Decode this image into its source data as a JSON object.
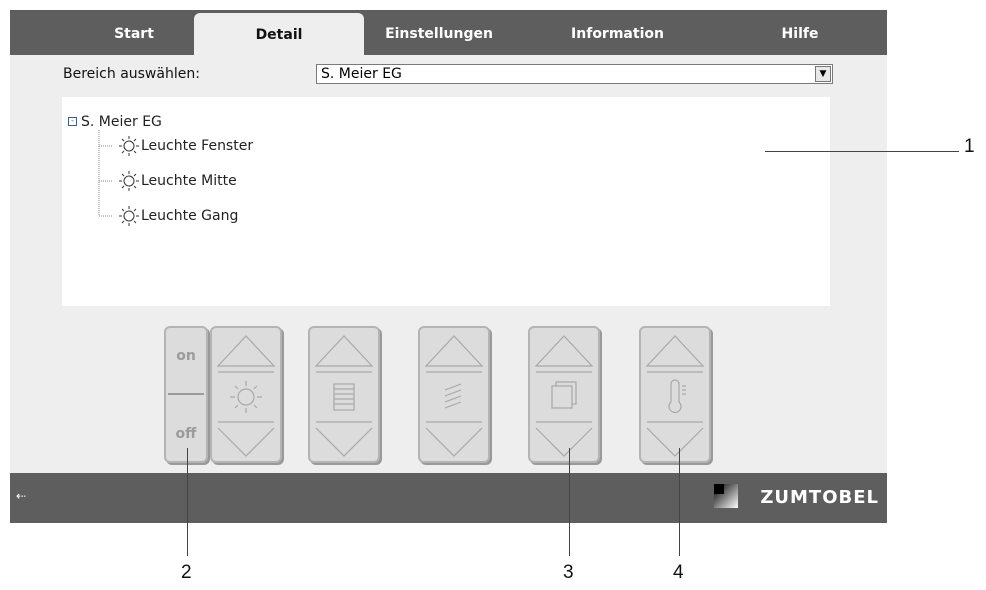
{
  "tabs": [
    {
      "label": "Start",
      "active": false
    },
    {
      "label": "Detail",
      "active": true
    },
    {
      "label": "Einstellungen",
      "active": false
    },
    {
      "label": "Information",
      "active": false
    },
    {
      "label": "Hilfe",
      "active": false
    }
  ],
  "area": {
    "label": "Bereich auswählen:",
    "selected": "S. Meier EG"
  },
  "tree": {
    "root": "S. Meier EG",
    "items": [
      "Leuchte Fenster",
      "Leuchte Mitte",
      "Leuchte Gang"
    ]
  },
  "controls": {
    "on_label": "on",
    "off_label": "off",
    "buttons": [
      {
        "icon": "brightness-icon"
      },
      {
        "icon": "blinds-icon"
      },
      {
        "icon": "slats-icon"
      },
      {
        "icon": "window-icon"
      },
      {
        "icon": "thermometer-icon"
      }
    ]
  },
  "footer": {
    "brand": "ZUMTOBEL",
    "exit_icon": "⇠"
  },
  "callouts": [
    "1",
    "2",
    "3",
    "4"
  ],
  "colors": {
    "bar": "#5e5e5e",
    "panel": "#eeeeee",
    "button": "#dcdcdc",
    "tree_line": "#3b5aa6"
  }
}
